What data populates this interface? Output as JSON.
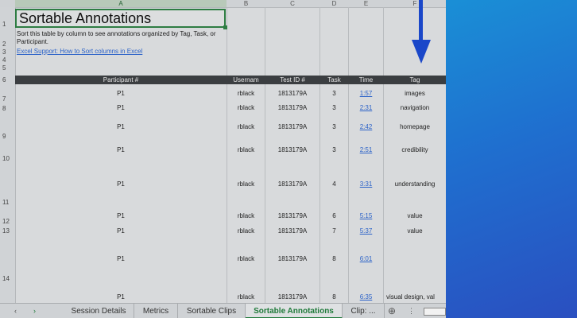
{
  "columns": [
    "A",
    "B",
    "C",
    "D",
    "E",
    "F"
  ],
  "row_numbers": [
    "1",
    "2",
    "3",
    "4",
    "5",
    "6",
    "7",
    "8",
    "9",
    "10",
    "11",
    "12",
    "13",
    "14"
  ],
  "title": "Sortable Annotations",
  "intro_text": "Sort this table by column to see annotations organized by Tag, Task, or Participant.",
  "help_link": "Excel Support: How to Sort columns in Excel",
  "headers": [
    "Participant #",
    "Usernam",
    "Test ID #",
    "Task",
    "Time",
    "Tag"
  ],
  "rows": [
    {
      "participant": "P1",
      "username": "rblack",
      "test_id": "1813179A",
      "task": "3",
      "time": "1:57",
      "tag": "images"
    },
    {
      "participant": "P1",
      "username": "rblack",
      "test_id": "1813179A",
      "task": "3",
      "time": "2:31",
      "tag": "navigation"
    },
    {
      "participant": "P1",
      "username": "rblack",
      "test_id": "1813179A",
      "task": "3",
      "time": "2:42",
      "tag": "homepage"
    },
    {
      "participant": "P1",
      "username": "rblack",
      "test_id": "1813179A",
      "task": "3",
      "time": "2:51",
      "tag": "credibility"
    },
    {
      "participant": "P1",
      "username": "rblack",
      "test_id": "1813179A",
      "task": "4",
      "time": "3:31",
      "tag": "understanding"
    },
    {
      "participant": "P1",
      "username": "rblack",
      "test_id": "1813179A",
      "task": "6",
      "time": "5:15",
      "tag": "value"
    },
    {
      "participant": "P1",
      "username": "rblack",
      "test_id": "1813179A",
      "task": "7",
      "time": "5:37",
      "tag": "value"
    },
    {
      "participant": "P1",
      "username": "rblack",
      "test_id": "1813179A",
      "task": "8",
      "time": "6:01",
      "tag": ""
    },
    {
      "participant": "P1",
      "username": "rblack",
      "test_id": "1813179A",
      "task": "8",
      "time": "6:35",
      "tag": "visual design, val"
    }
  ],
  "tabs": [
    "Session Details",
    "Metrics",
    "Sortable Clips",
    "Sortable Annotations",
    "Clip: ..."
  ],
  "active_tab": "Sortable Annotations",
  "nav": {
    "prev": "‹",
    "next": "›",
    "add": "⊕"
  },
  "accent_color": "#1a47c9",
  "sheet_accent": "#1f7a3a"
}
